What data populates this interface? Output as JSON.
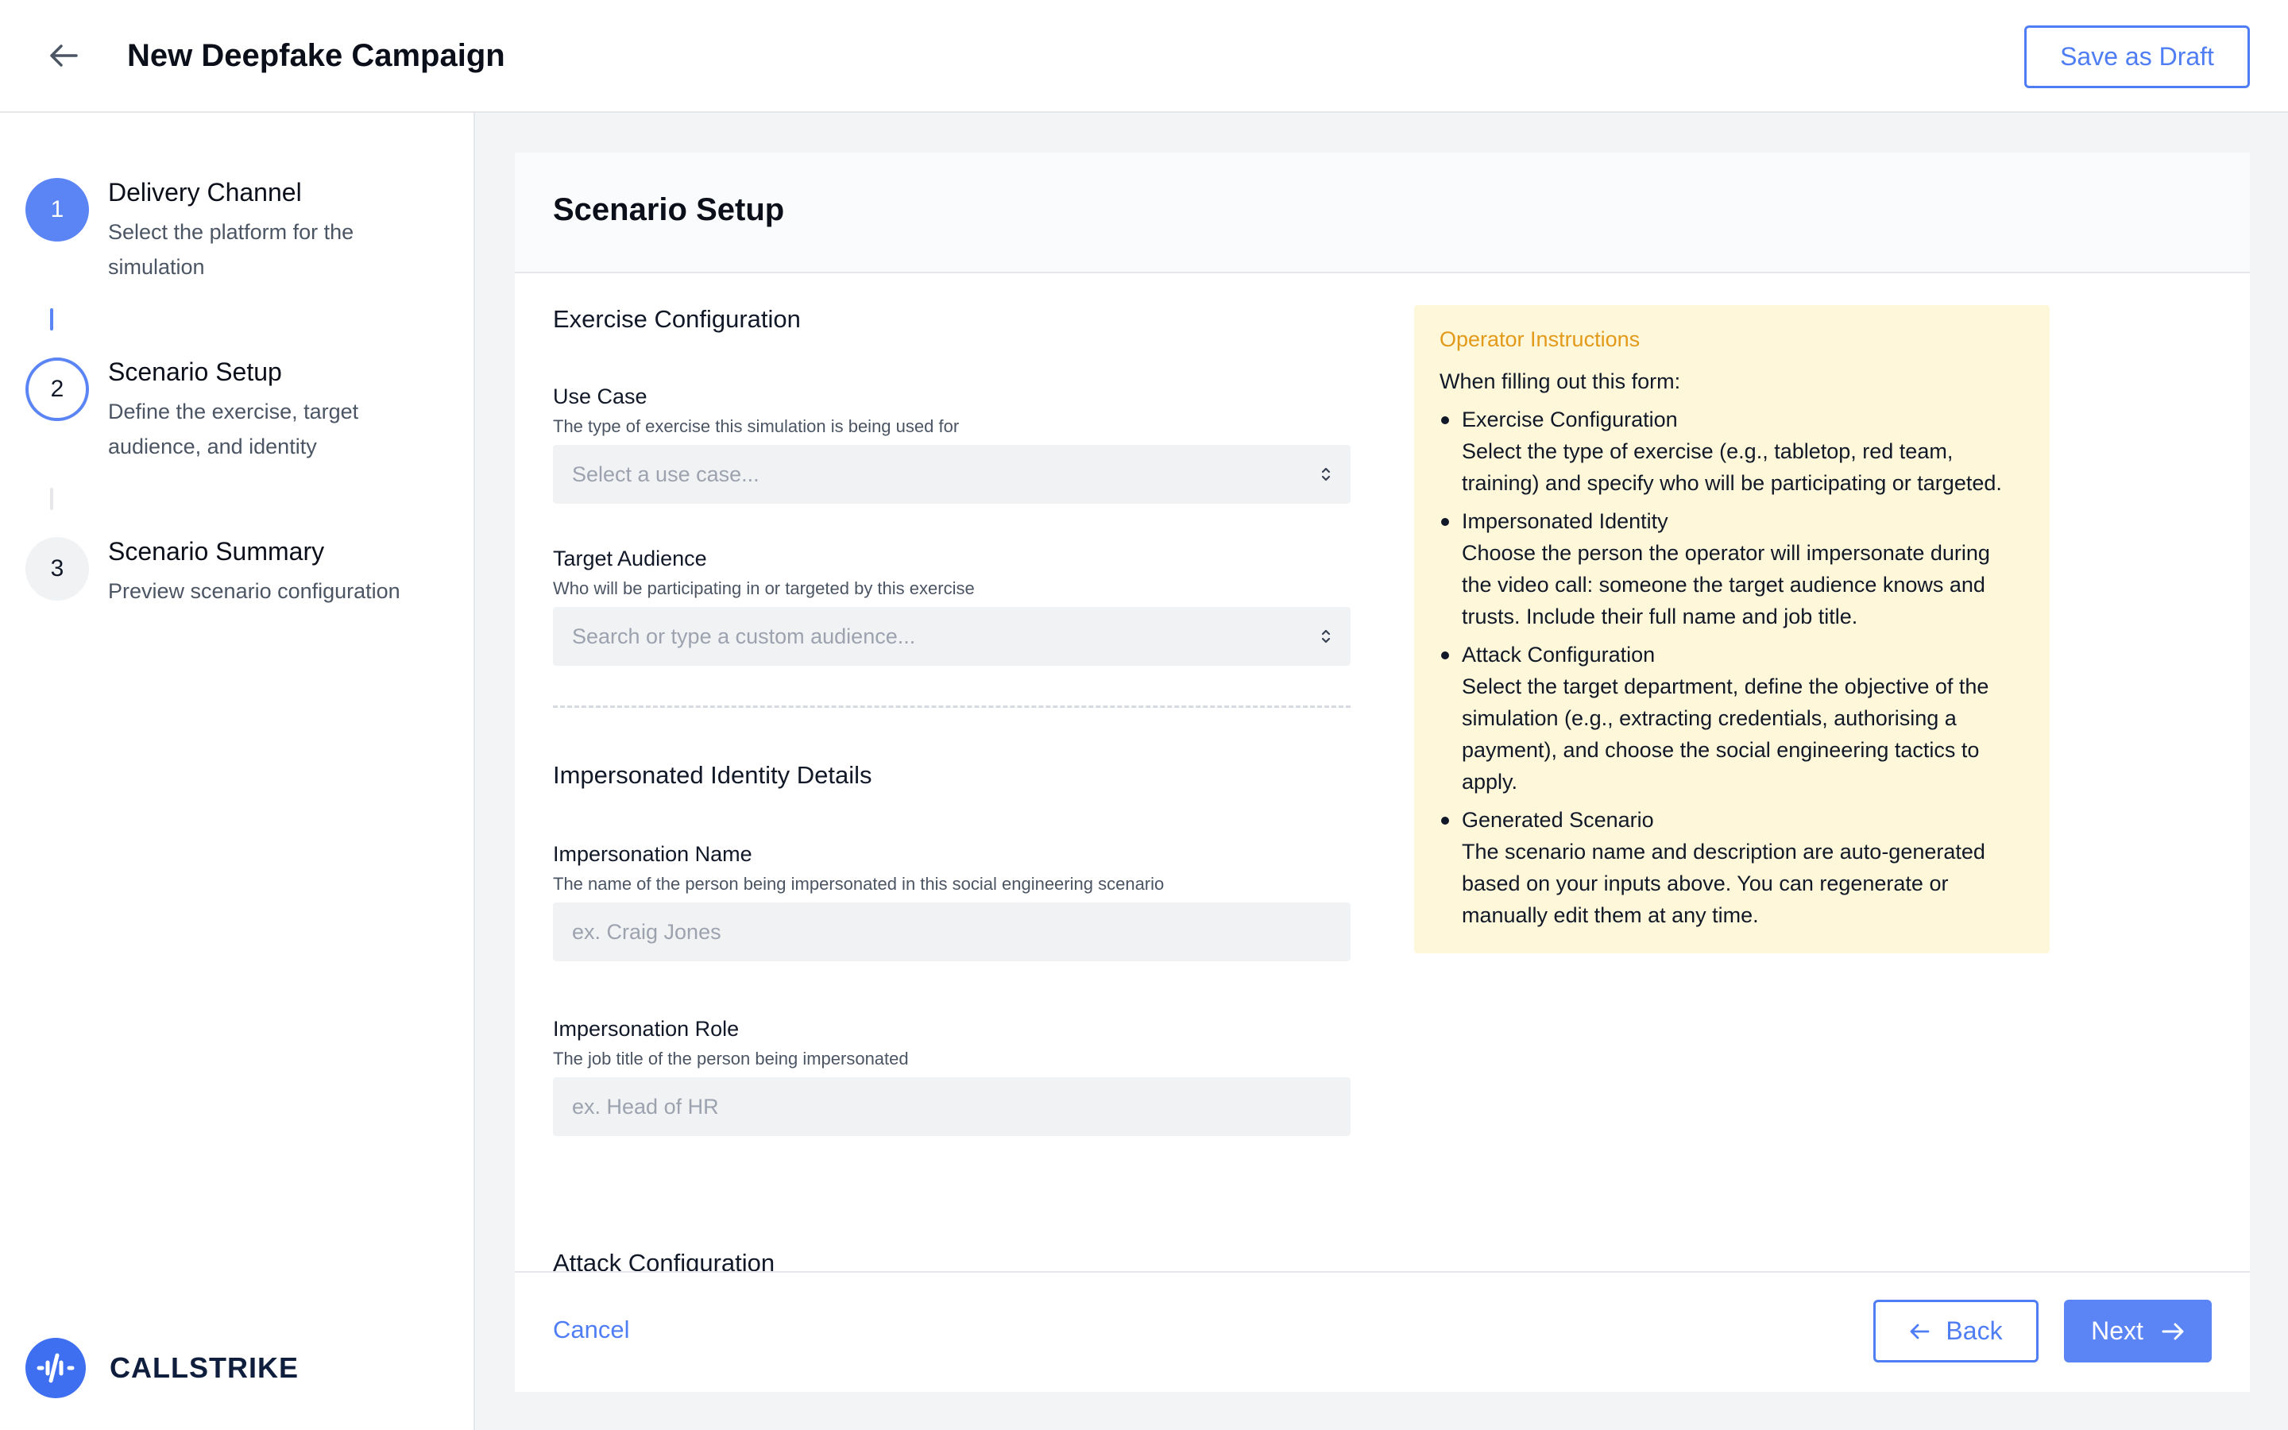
{
  "header": {
    "back_icon": "arrow-left-icon",
    "title": "New Deepfake Campaign",
    "save_draft_label": "Save as Draft"
  },
  "colors": {
    "accent": "#5b84f5",
    "accent_text": "#4f7df3",
    "instructions_bg": "#fef7d9",
    "instructions_title": "#e39a1a"
  },
  "steps": [
    {
      "number": "1",
      "title": "Delivery Channel",
      "desc": "Select the platform for the simulation",
      "state": "complete"
    },
    {
      "number": "2",
      "title": "Scenario Setup",
      "desc": "Define the exercise, target audience, and identity",
      "state": "current"
    },
    {
      "number": "3",
      "title": "Scenario Summary",
      "desc": "Preview scenario configuration",
      "state": "pending"
    }
  ],
  "brand": {
    "logo_icon": "callstrike-logo-icon",
    "name": "CALLSTRIKE"
  },
  "card": {
    "title": "Scenario Setup"
  },
  "exercise": {
    "section_title": "Exercise Configuration",
    "use_case": {
      "label": "Use Case",
      "help": "The type of exercise this simulation is being used for",
      "placeholder": "Select a use case..."
    },
    "audience": {
      "label": "Target Audience",
      "help": "Who will be participating in or targeted by this exercise",
      "placeholder": "Search or type a custom audience..."
    }
  },
  "identity": {
    "section_title": "Impersonated Identity Details",
    "name": {
      "label": "Impersonation Name",
      "help": "The name of the person being impersonated in this social engineering scenario",
      "placeholder": "ex. Craig Jones"
    },
    "role": {
      "label": "Impersonation Role",
      "help": "The job title of the person being impersonated",
      "placeholder": "ex. Head of HR"
    }
  },
  "attack": {
    "section_title": "Attack Configuration"
  },
  "instructions": {
    "title": "Operator Instructions",
    "intro": "When filling out this form:",
    "items": [
      {
        "heading": "Exercise Configuration",
        "body": "Select the type of exercise (e.g., tabletop, red team, training) and specify who will be participating or targeted."
      },
      {
        "heading": "Impersonated Identity",
        "body": "Choose the person the operator will impersonate during the video call: someone the target audience knows and trusts. Include their full name and job title."
      },
      {
        "heading": "Attack Configuration",
        "body": "Select the target department, define the objective of the simulation (e.g., extracting credentials, authorising a payment), and choose the social engineering tactics to apply."
      },
      {
        "heading": "Generated Scenario",
        "body": "The scenario name and description are auto-generated based on your inputs above. You can regenerate or manually edit them at any time."
      }
    ]
  },
  "footer": {
    "cancel_label": "Cancel",
    "back_label": "Back",
    "next_label": "Next"
  }
}
